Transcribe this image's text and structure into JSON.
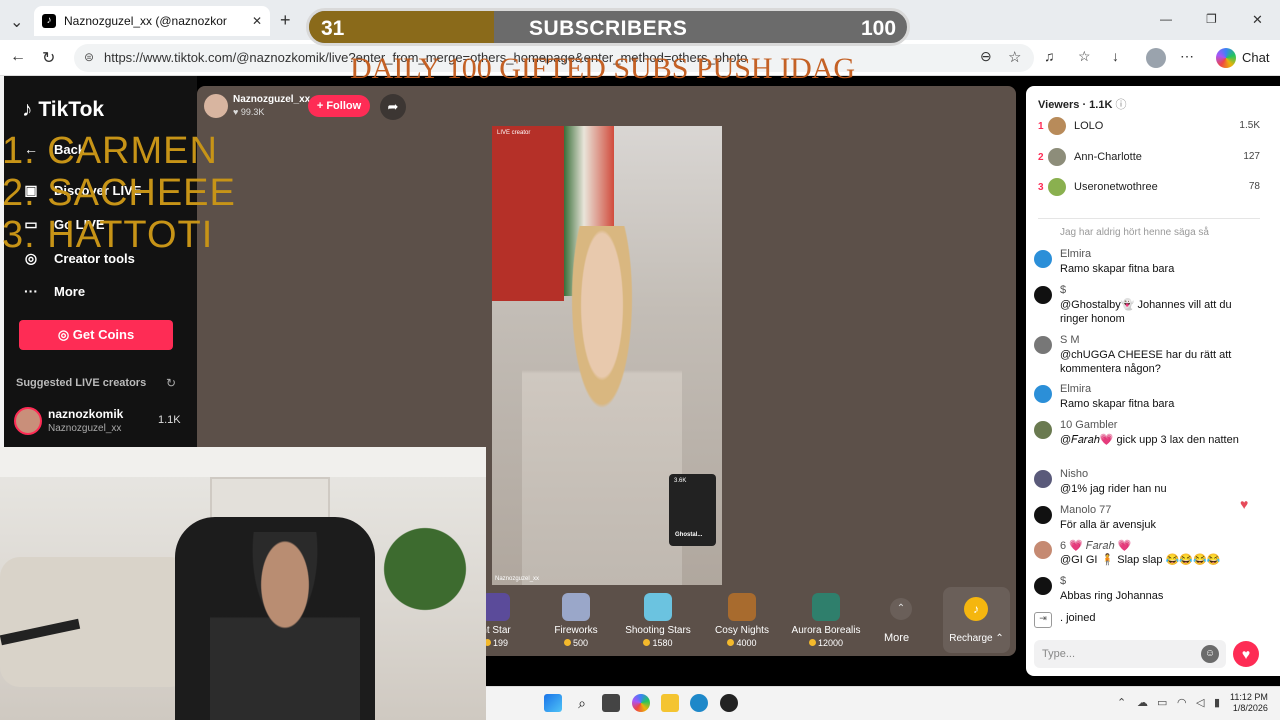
{
  "browser": {
    "tab_title": "Naznozguzel_xx (@naznozkor",
    "url": "https://www.tiktok.com/@naznozkomik/live?enter_from_merge=others_homepage&enter_method=others_photo",
    "chat_label": "Chat"
  },
  "overlay": {
    "sub_current": "31",
    "sub_label": "SUBSCRIBERS",
    "sub_goal": "100",
    "sub_progress_fraction": 0.31,
    "headline": "DAILY 100  GIFTED SUBS PUSH IDAG",
    "rankings": [
      "1. CARMEN",
      "2. SACHEEE",
      "3. HATTOTI"
    ]
  },
  "sidebar": {
    "logo": "TikTok",
    "nav": [
      {
        "label": "Back",
        "icon": "back-arrow-icon"
      },
      {
        "label": "Discover LIVE",
        "icon": "live-tv-icon"
      },
      {
        "label": "Go LIVE",
        "icon": "camera-icon"
      },
      {
        "label": "Creator tools",
        "icon": "lightbulb-icon"
      },
      {
        "label": "More",
        "icon": "more-dots-icon"
      }
    ],
    "get_coins": "Get Coins",
    "suggested_title": "Suggested LIVE creators",
    "creator": {
      "name": "naznozkomik",
      "handle": "Naznozguzel_xx",
      "count": "1.1K"
    }
  },
  "stream": {
    "host_name": "Naznozguzel_xx",
    "host_likes": "99.3K",
    "follow_label": "+ Follow",
    "live_tag": "LIVE creator",
    "watermark": "Naznozguzel_xx",
    "mini_count": "3.6K",
    "mini_name": "Ghostal..."
  },
  "gifts": [
    {
      "name": "ht Star",
      "price": "199",
      "color": "#5b4b9a"
    },
    {
      "name": "Fireworks",
      "price": "500",
      "color": "#9aa7c9"
    },
    {
      "name": "Shooting Stars",
      "price": "1580",
      "color": "#6bc3e0"
    },
    {
      "name": "Cosy Nights",
      "price": "4000",
      "color": "#a86b2e"
    },
    {
      "name": "Aurora Borealis",
      "price": "12000",
      "color": "#2f7f6c"
    }
  ],
  "gift_more": "More",
  "recharge": "Recharge",
  "viewers": {
    "title": "Viewers · 1.1K",
    "list": [
      {
        "rank": "1",
        "name": "LOLO",
        "count": "1.5K",
        "color": "#b88b5a"
      },
      {
        "rank": "2",
        "name": "Ann-Charlotte",
        "count": "127",
        "color": "#8d8d7a"
      },
      {
        "rank": "3",
        "name": "Useronetwothree",
        "count": "78",
        "color": "#8ab04f"
      }
    ]
  },
  "chat": {
    "faded": "Jag har aldrig hört henne säga så",
    "messages": [
      {
        "user": "Elmira",
        "text": "Ramo skapar fitna bara",
        "color": "#2b8fd8"
      },
      {
        "user": "$",
        "text": "@Ghostalby👻 Johannes vill att du ringer honom",
        "color": "#111111"
      },
      {
        "user": "S M",
        "text": "@chUGGA CHEESE har du rätt att kommentera någon?",
        "color": "#777777"
      },
      {
        "user": "Elmira",
        "text": "Ramo skapar fitna bara",
        "color": "#2b8fd8"
      },
      {
        "user": "10 Gambler",
        "text": "@𝐹𝑎𝑟𝑎ℎ💗 gick upp 3 lax den natten",
        "color": "#6a7a50"
      },
      {
        "user": "Nisho",
        "text": "@1% jag rider han nu",
        "color": "#5a5a7a"
      },
      {
        "user": "Manolo 77",
        "text": "För alla är avensjuk",
        "color": "#111111"
      },
      {
        "user": "6 💗 𝐹𝑎𝑟𝑎ℎ 💗",
        "text": "@GI GI 🧍 Slap slap 😂😂😂😂",
        "color": "#c58a72"
      },
      {
        "user": "$",
        "text": "Abbas ring Johannas",
        "color": "#111111"
      }
    ],
    "joined": ". joined",
    "placeholder": "Type..."
  },
  "taskbar": {
    "time": "11:12 PM",
    "date": "1/8/2026"
  }
}
